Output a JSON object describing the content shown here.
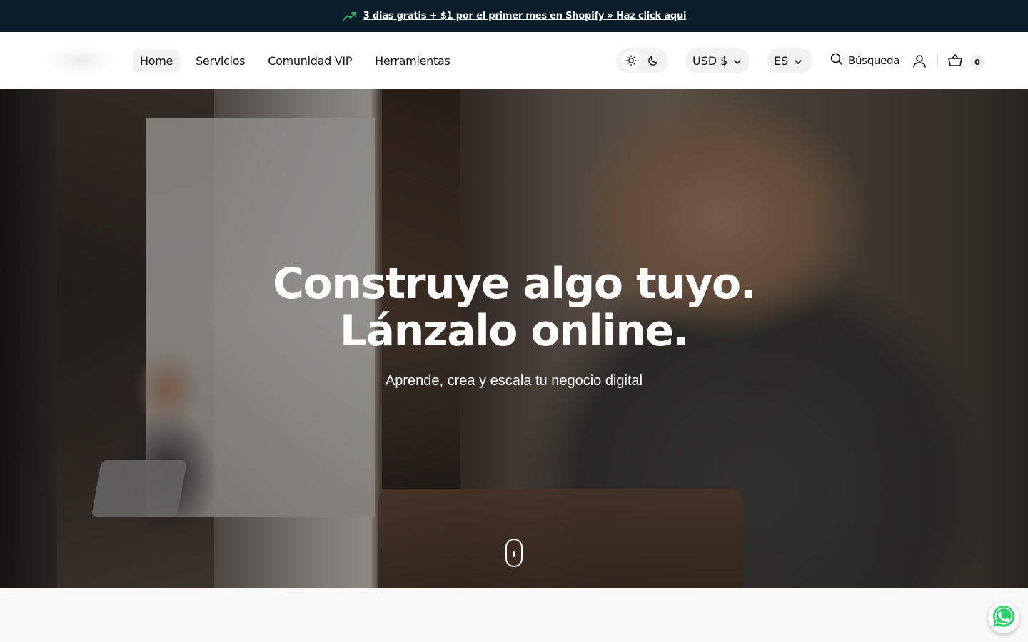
{
  "announcement": {
    "text": "3 dias gratis + $1 por el primer mes en Shopify » Haz click aqui",
    "icon": "trending-up-icon"
  },
  "nav": {
    "items": [
      {
        "label": "Home",
        "active": true
      },
      {
        "label": "Servicios"
      },
      {
        "label": "Comunidad VIP"
      },
      {
        "label": "Herramientas"
      }
    ]
  },
  "header": {
    "theme": {
      "light_icon": "sun-icon",
      "dark_icon": "moon-icon",
      "selected": "light"
    },
    "currency": "USD $",
    "language": "ES",
    "search_label": "Búsqueda",
    "cart_count": "0"
  },
  "hero": {
    "title_line1": "Construye algo tuyo.",
    "title_line2": "Lánzalo online.",
    "subtitle": "Aprende, crea y escala tu negocio digital"
  },
  "colors": {
    "announcement_bg": "#0a1d2b",
    "header_bg": "#ffffff",
    "pill_bg": "#f2f2f2",
    "whatsapp_green": "#25d366"
  }
}
